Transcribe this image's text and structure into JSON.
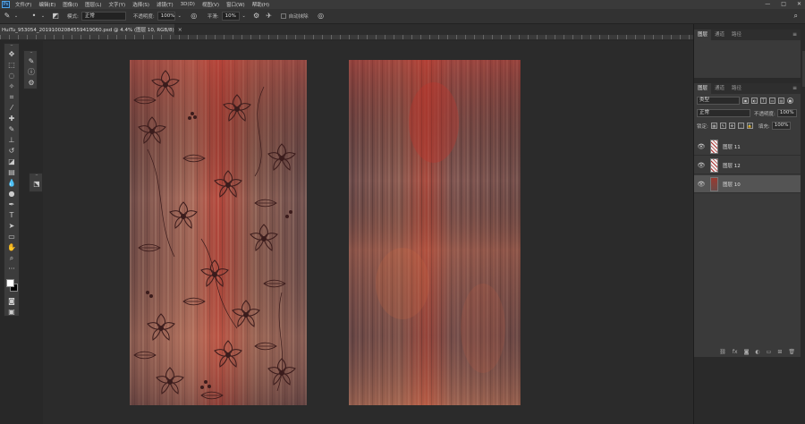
{
  "menu": {
    "logo": "Ps",
    "items": [
      "文件(F)",
      "编辑(E)",
      "图像(I)",
      "图层(L)",
      "文字(Y)",
      "选择(S)",
      "滤镜(T)",
      "3D(D)",
      "视图(V)",
      "窗口(W)",
      "帮助(H)"
    ],
    "window_controls": [
      "—",
      "□",
      "✕"
    ]
  },
  "options": {
    "mode_label": "模式:",
    "mode_value": "正常",
    "opacity_label": "不透明度:",
    "opacity_value": "100%",
    "flow_label": "平滑:",
    "flow_value": "10%",
    "auto_erase_label": "自动抹除"
  },
  "document": {
    "tab_title": "HuiTu_953054_20191002084559419060.psd @ 4.4% (图层 10, RGB/8)",
    "close_symbol": "×"
  },
  "panels": {
    "top_tabs": [
      "图层",
      "通道",
      "路径"
    ],
    "layers_tabs": [
      "图层",
      "通道",
      "路径"
    ],
    "filter_kind": "类型",
    "blend_mode": "正常",
    "opacity_label": "不透明度:",
    "opacity_value": "100%",
    "lock_label": "锁定:",
    "fill_label": "填充:",
    "fill_value": "100%",
    "layers": [
      {
        "name": "图层 11",
        "visible": true,
        "selected": false,
        "thumb": "floral"
      },
      {
        "name": "图层 12",
        "visible": true,
        "selected": false,
        "thumb": "floral"
      },
      {
        "name": "图层 10",
        "visible": true,
        "selected": true,
        "thumb": "texture"
      }
    ]
  },
  "colors": {
    "foreground": "#ffffff",
    "background": "#000000",
    "accent": "#31a8ff"
  }
}
